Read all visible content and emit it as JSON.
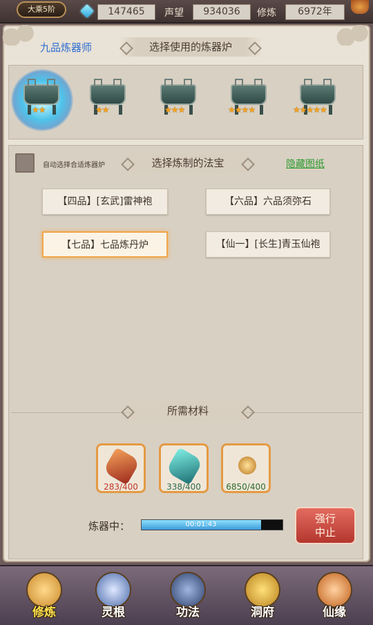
{
  "topbar": {
    "rank": "大乘5阶",
    "spirit_stones": "147465",
    "prestige_label": "声望",
    "prestige": "934036",
    "cultivation_label": "修炼",
    "cultivation": "6972年"
  },
  "header": {
    "craftsman_title": "九品炼器师",
    "furnace_section_title": "选择使用的炼器炉"
  },
  "furnaces": [
    {
      "stars": 2,
      "selected": true
    },
    {
      "stars": 2,
      "selected": false
    },
    {
      "stars": 3,
      "selected": false
    },
    {
      "stars": 4,
      "selected": false
    },
    {
      "stars": 5,
      "selected": false
    }
  ],
  "treasure": {
    "auto_select_label": "自动选择合适炼器炉",
    "section_title": "选择炼制的法宝",
    "hide_blueprints": "隐藏图纸",
    "items": [
      {
        "label": "【四品】[玄武]雷神袍",
        "selected": false
      },
      {
        "label": "【六品】六品须弥石",
        "selected": false
      },
      {
        "label": "【七品】七品炼丹炉",
        "selected": true
      },
      {
        "label": "【仙一】[长生]青玉仙袍",
        "selected": false
      }
    ]
  },
  "materials": {
    "section_title": "所需材料",
    "items": [
      {
        "count": "283/400",
        "color": "#c0392b"
      },
      {
        "count": "338/400",
        "color": "#2e6d4f"
      },
      {
        "count": "6850/400",
        "color": "#2e6d2e"
      }
    ]
  },
  "progress": {
    "label": "炼器中：",
    "time": "00:01:43",
    "fraction": 0.85,
    "stop_label": "强行\n中止"
  },
  "nav": [
    {
      "label": "修炼",
      "active": true
    },
    {
      "label": "灵根",
      "active": false
    },
    {
      "label": "功法",
      "active": false
    },
    {
      "label": "洞府",
      "active": false
    },
    {
      "label": "仙缘",
      "active": false
    }
  ],
  "colors": {
    "accent_orange": "#f0a64a",
    "link_green": "#2f9a2f",
    "title_blue": "#2f6fd1",
    "progress_blue": "#3c9bd8",
    "stop_red": "#b4362e"
  }
}
